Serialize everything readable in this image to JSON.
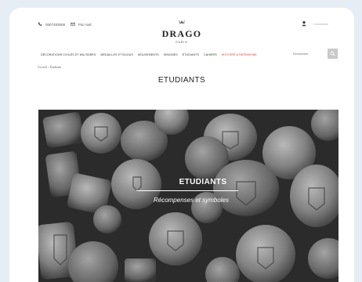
{
  "header": {
    "phone": "0607483508",
    "mail_label": "Par mail",
    "logo": "DRAGO",
    "logo_sub": "PARIS",
    "account_label": "Connexion"
  },
  "nav": {
    "items": [
      {
        "label": "DÉCORATIONS CIVILES ET MILITAIRES"
      },
      {
        "label": "MÉDAILLES ET BIJOUX"
      },
      {
        "label": "MOUVEMENTS"
      },
      {
        "label": "INSIGNES"
      },
      {
        "label": "ÉTUDIANTS"
      },
      {
        "label": "CAHIERS"
      },
      {
        "label": "HISTOIRE & PATRIMOINE"
      }
    ],
    "search_placeholder": "Rechercher"
  },
  "breadcrumb": "Accueil > Étudiants",
  "page": {
    "title": "ETUDIANTS"
  },
  "hero": {
    "title": "ETUDIANTS",
    "subtitle": "Récompenses et symboles"
  },
  "colors": {
    "accent": "#c8442f",
    "background": "#e6edf4"
  }
}
